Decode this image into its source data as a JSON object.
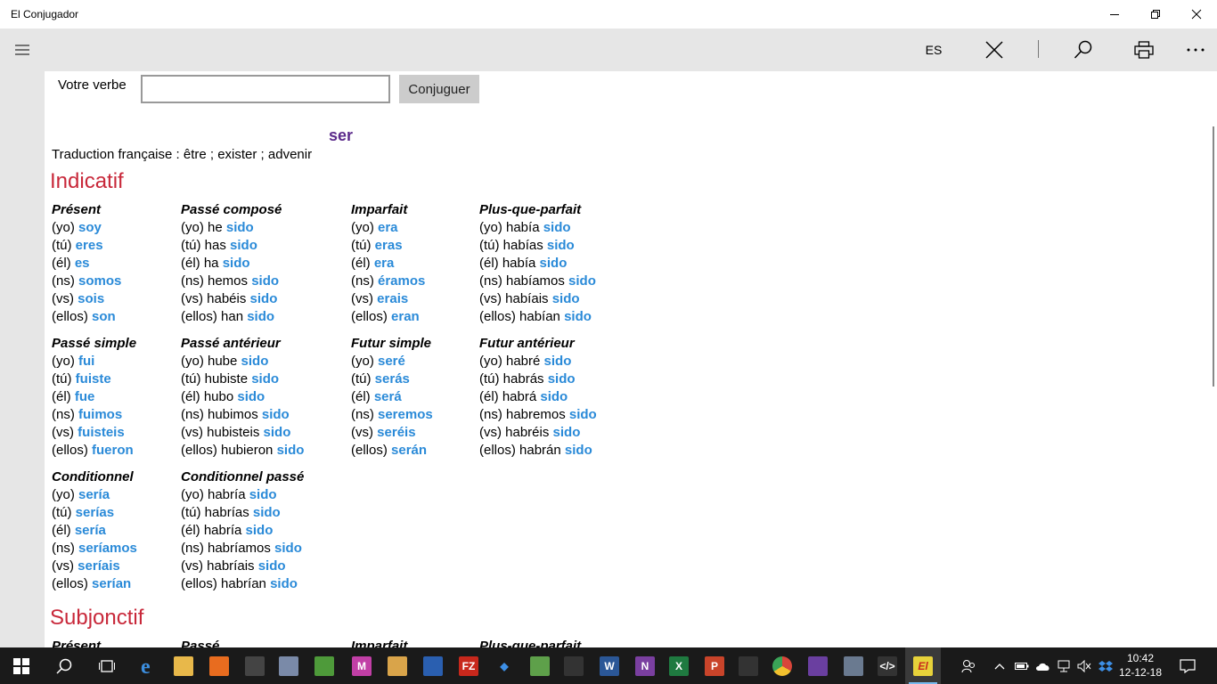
{
  "window": {
    "title": "El Conjugador"
  },
  "commandbar": {
    "language": "ES"
  },
  "form": {
    "label": "Votre verbe",
    "input_value": "",
    "button_label": "Conjuguer"
  },
  "verb": {
    "infinitive": "ser",
    "translation": "Traduction française : être ; exister ; advenir"
  },
  "moods": [
    {
      "name": "Indicatif",
      "tenses": [
        {
          "name": "Présent",
          "rows": [
            {
              "pre": "(yo) ",
              "form": "soy"
            },
            {
              "pre": "(tú) ",
              "form": "eres"
            },
            {
              "pre": "(él) ",
              "form": "es"
            },
            {
              "pre": "(ns) ",
              "form": "somos"
            },
            {
              "pre": "(vs) ",
              "form": "sois"
            },
            {
              "pre": "(ellos) ",
              "form": "son"
            }
          ]
        },
        {
          "name": "Passé composé",
          "rows": [
            {
              "pre": "(yo) he ",
              "form": "sido"
            },
            {
              "pre": "(tú) has ",
              "form": "sido"
            },
            {
              "pre": "(él) ha ",
              "form": "sido"
            },
            {
              "pre": "(ns) hemos ",
              "form": "sido"
            },
            {
              "pre": "(vs) habéis ",
              "form": "sido"
            },
            {
              "pre": "(ellos) han ",
              "form": "sido"
            }
          ]
        },
        {
          "name": "Imparfait",
          "rows": [
            {
              "pre": "(yo) ",
              "form": "era"
            },
            {
              "pre": "(tú) ",
              "form": "eras"
            },
            {
              "pre": "(él) ",
              "form": "era"
            },
            {
              "pre": "(ns) ",
              "form": "éramos"
            },
            {
              "pre": "(vs) ",
              "form": "erais"
            },
            {
              "pre": "(ellos) ",
              "form": "eran"
            }
          ]
        },
        {
          "name": "Plus-que-parfait",
          "rows": [
            {
              "pre": "(yo) había ",
              "form": "sido"
            },
            {
              "pre": "(tú) habías ",
              "form": "sido"
            },
            {
              "pre": "(él) había ",
              "form": "sido"
            },
            {
              "pre": "(ns) habíamos ",
              "form": "sido"
            },
            {
              "pre": "(vs) habíais ",
              "form": "sido"
            },
            {
              "pre": "(ellos) habían ",
              "form": "sido"
            }
          ]
        },
        {
          "name": "Passé simple",
          "rows": [
            {
              "pre": "(yo) ",
              "form": "fui"
            },
            {
              "pre": "(tú) ",
              "form": "fuiste"
            },
            {
              "pre": "(él) ",
              "form": "fue"
            },
            {
              "pre": "(ns) ",
              "form": "fuimos"
            },
            {
              "pre": "(vs) ",
              "form": "fuisteis"
            },
            {
              "pre": "(ellos) ",
              "form": "fueron"
            }
          ]
        },
        {
          "name": "Passé antérieur",
          "rows": [
            {
              "pre": "(yo) hube ",
              "form": "sido"
            },
            {
              "pre": "(tú) hubiste ",
              "form": "sido"
            },
            {
              "pre": "(él) hubo ",
              "form": "sido"
            },
            {
              "pre": "(ns) hubimos ",
              "form": "sido"
            },
            {
              "pre": "(vs) hubisteis ",
              "form": "sido"
            },
            {
              "pre": "(ellos) hubieron ",
              "form": "sido"
            }
          ]
        },
        {
          "name": "Futur simple",
          "rows": [
            {
              "pre": "(yo) ",
              "form": "seré"
            },
            {
              "pre": "(tú) ",
              "form": "serás"
            },
            {
              "pre": "(él) ",
              "form": "será"
            },
            {
              "pre": "(ns) ",
              "form": "seremos"
            },
            {
              "pre": "(vs) ",
              "form": "seréis"
            },
            {
              "pre": "(ellos) ",
              "form": "serán"
            }
          ]
        },
        {
          "name": "Futur antérieur",
          "rows": [
            {
              "pre": "(yo) habré ",
              "form": "sido"
            },
            {
              "pre": "(tú) habrás ",
              "form": "sido"
            },
            {
              "pre": "(él) habrá ",
              "form": "sido"
            },
            {
              "pre": "(ns) habremos ",
              "form": "sido"
            },
            {
              "pre": "(vs) habréis ",
              "form": "sido"
            },
            {
              "pre": "(ellos) habrán ",
              "form": "sido"
            }
          ]
        },
        {
          "name": "Conditionnel",
          "rows": [
            {
              "pre": "(yo) ",
              "form": "sería"
            },
            {
              "pre": "(tú) ",
              "form": "serías"
            },
            {
              "pre": "(él) ",
              "form": "sería"
            },
            {
              "pre": "(ns) ",
              "form": "seríamos"
            },
            {
              "pre": "(vs) ",
              "form": "seríais"
            },
            {
              "pre": "(ellos) ",
              "form": "serían"
            }
          ]
        },
        {
          "name": "Conditionnel passé",
          "rows": [
            {
              "pre": "(yo) habría ",
              "form": "sido"
            },
            {
              "pre": "(tú) habrías ",
              "form": "sido"
            },
            {
              "pre": "(él) habría ",
              "form": "sido"
            },
            {
              "pre": "(ns) habríamos ",
              "form": "sido"
            },
            {
              "pre": "(vs) habríais ",
              "form": "sido"
            },
            {
              "pre": "(ellos) habrían ",
              "form": "sido"
            }
          ]
        }
      ]
    },
    {
      "name": "Subjonctif",
      "tenses": [
        {
          "name": "Présent",
          "rows": []
        },
        {
          "name": "Passé",
          "rows": []
        },
        {
          "name": "Imparfait",
          "rows": []
        },
        {
          "name": "Plus-que-parfait",
          "rows": []
        }
      ]
    }
  ],
  "taskbar": {
    "apps": [
      "file-explorer",
      "firefox",
      "store",
      "app-1",
      "app-2",
      "onenote-purple",
      "app-3",
      "app-4",
      "filezilla",
      "dropbox",
      "android-studio",
      "terminal",
      "word",
      "onenote",
      "excel",
      "powerpoint",
      "app-5",
      "chrome",
      "visual-studio",
      "app-6",
      "code-editor",
      "el-conjugador"
    ],
    "clock_time": "10:42",
    "clock_date": "12-12-18"
  },
  "colors": {
    "accent_conj": "#2a8ad8",
    "mood": "#c8283a",
    "verb_title": "#5b2a8b",
    "bar_bg": "#e6e6e6"
  }
}
